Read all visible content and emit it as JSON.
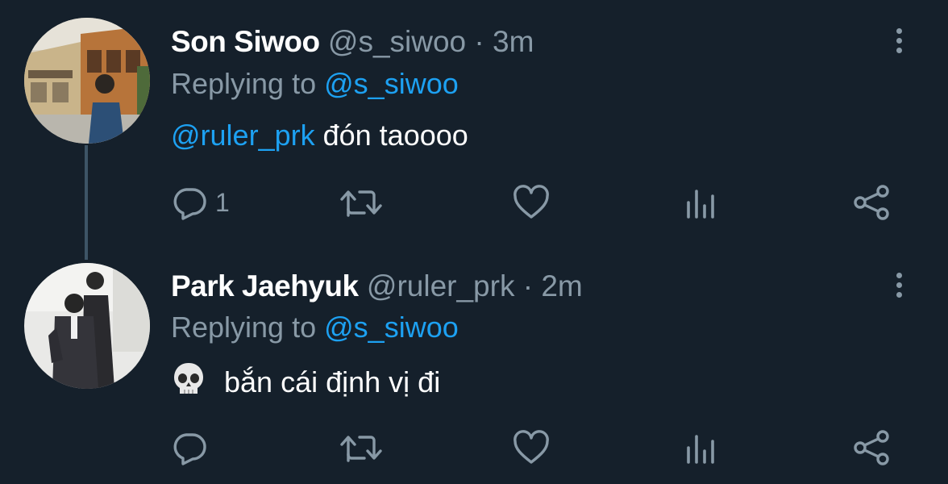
{
  "tweets": [
    {
      "display_name": "Son Siwoo",
      "handle": "@s_siwoo",
      "separator": "·",
      "time": "3m",
      "replying_prefix": "Replying to",
      "replying_to": "@s_siwoo",
      "mention": "@ruler_prk",
      "text": "đón taoooo",
      "reply_count": "1"
    },
    {
      "display_name": "Park Jaehyuk",
      "handle": "@ruler_prk",
      "separator": "·",
      "time": "2m",
      "replying_prefix": "Replying to",
      "replying_to": "@s_siwoo",
      "emoji": "skull-emoji",
      "text": "bắn cái định vị đi",
      "reply_count": ""
    }
  ],
  "colors": {
    "background": "#15202b",
    "secondary_text": "#8899a6",
    "link": "#1da1f2",
    "thread_line": "#3d5466"
  },
  "icons": [
    "reply-icon",
    "retweet-icon",
    "like-icon",
    "analytics-icon",
    "share-icon",
    "more-options-icon"
  ]
}
